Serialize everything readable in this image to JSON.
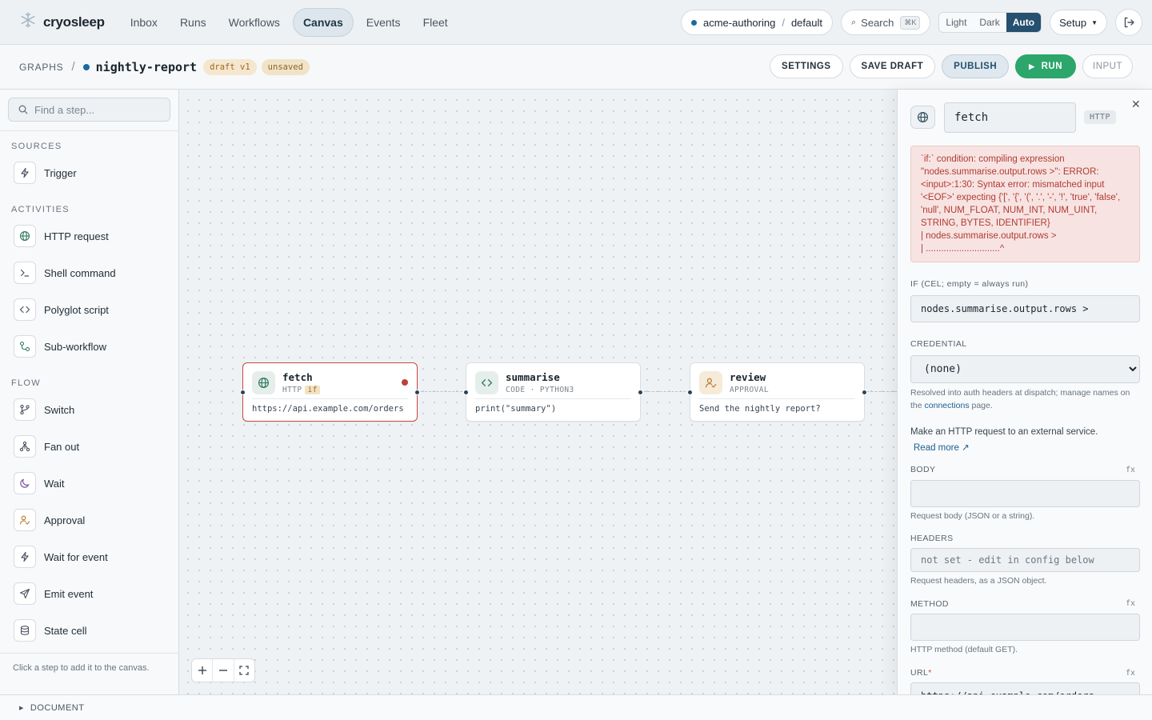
{
  "app": {
    "brand": "cryosleep",
    "nav": [
      "Inbox",
      "Runs",
      "Workflows",
      "Canvas",
      "Events",
      "Fleet"
    ],
    "active_nav": "Canvas",
    "workspace": {
      "org": "acme-authoring",
      "env": "default"
    },
    "search": {
      "label": "Search",
      "shortcut": "⌘K"
    },
    "theme": {
      "options": [
        "Light",
        "Dark",
        "Auto"
      ],
      "selected": "Auto"
    },
    "setup_label": "Setup"
  },
  "graph": {
    "crumb_root": "GRAPHS",
    "title": "nightly-report",
    "badges": {
      "draft": "draft v1",
      "unsaved": "unsaved"
    },
    "actions": {
      "settings": "SETTINGS",
      "save": "SAVE DRAFT",
      "publish": "PUBLISH",
      "run": "RUN",
      "input": "INPUT"
    }
  },
  "sidebar": {
    "search_placeholder": "Find a step...",
    "sections": [
      {
        "title": "SOURCES",
        "items": [
          {
            "label": "Trigger",
            "icon": "bolt-icon"
          }
        ]
      },
      {
        "title": "ACTIVITIES",
        "items": [
          {
            "label": "HTTP request",
            "icon": "globe-icon"
          },
          {
            "label": "Shell command",
            "icon": "terminal-icon"
          },
          {
            "label": "Polyglot script",
            "icon": "code-icon"
          },
          {
            "label": "Sub-workflow",
            "icon": "subflow-icon"
          }
        ]
      },
      {
        "title": "FLOW",
        "items": [
          {
            "label": "Switch",
            "icon": "branch-icon"
          },
          {
            "label": "Fan out",
            "icon": "fanout-icon"
          },
          {
            "label": "Wait",
            "icon": "moon-icon"
          },
          {
            "label": "Approval",
            "icon": "user-check-icon"
          },
          {
            "label": "Wait for event",
            "icon": "bolt-icon"
          },
          {
            "label": "Emit event",
            "icon": "send-icon"
          },
          {
            "label": "State cell",
            "icon": "database-icon"
          }
        ]
      }
    ],
    "footer": "Click a step to add it to the canvas."
  },
  "canvas": {
    "nodes": [
      {
        "id": "fetch",
        "title": "fetch",
        "sub": "HTTP",
        "badge": "if",
        "body": "https://api.example.com/orders",
        "error": true
      },
      {
        "id": "summarise",
        "title": "summarise",
        "sub": "CODE · PYTHON3",
        "body": "print(\"summary\")"
      },
      {
        "id": "review",
        "title": "review",
        "sub": "APPROVAL",
        "body": "Send the nightly report?"
      }
    ]
  },
  "inspector": {
    "name": "fetch",
    "type": "HTTP",
    "error": "`if:` condition: compiling expression \"nodes.summarise.output.rows >\": ERROR: <input>:1:30: Syntax error: mismatched input '<EOF>' expecting {'[', '{', '(', '.', '-', '!', 'true', 'false', 'null', NUM_FLOAT, NUM_INT, NUM_UINT, STRING, BYTES, IDENTIFIER}\n| nodes.summarise.output.rows >\n| .............................^",
    "if_label": "IF (CEL; empty = always run)",
    "if_value": "nodes.summarise.output.rows >",
    "credential_label": "CREDENTIAL",
    "credential_value": "(none)",
    "credential_help_pre": "Resolved into auth headers at dispatch; manage names on the",
    "credential_help_link": "connections",
    "credential_help_post": "page.",
    "description": "Make an HTTP request to an external service.",
    "read_more": "Read more ↗",
    "fx": "fx",
    "body_label": "BODY",
    "body_help": "Request body (JSON or a string).",
    "headers_label": "HEADERS",
    "headers_placeholder": "not set - edit in config below",
    "headers_help": "Request headers, as a JSON object.",
    "method_label": "METHOD",
    "method_help": "HTTP method (default GET).",
    "url_label": "URL",
    "url_required": "*",
    "url_value": "https://api.example.com/orders"
  },
  "bottom": {
    "document_label": "DOCUMENT"
  },
  "colors": {
    "accent": "#25506f",
    "run": "#2da66b",
    "error": "#c8473f",
    "dot": "#1b6aa0"
  }
}
